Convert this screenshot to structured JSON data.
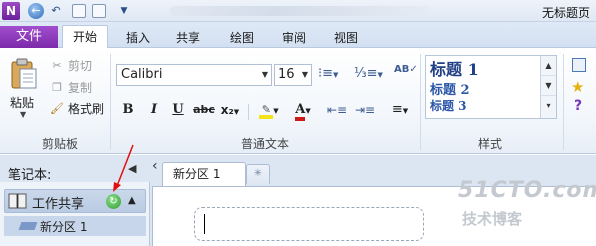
{
  "titlebar": {
    "window_title": "无标题页"
  },
  "tabs": {
    "file": "文件",
    "home": "开始",
    "insert": "插入",
    "share": "共享",
    "draw": "绘图",
    "review": "审阅",
    "view": "视图"
  },
  "clipboard": {
    "paste": "粘贴",
    "cut": "剪切",
    "copy": "复制",
    "format_painter": "格式刷",
    "group_label": "剪贴板"
  },
  "basic_text": {
    "font_name": "Calibri",
    "font_size": "16",
    "bold": "B",
    "italic": "I",
    "underline": "U",
    "strike": "abc",
    "subscript": "x₂",
    "group_label": "普通文本"
  },
  "styles": {
    "items": [
      "标题 1",
      "标题 2",
      "标题 3"
    ],
    "group_label": "样式"
  },
  "notebook_pane": {
    "label": "笔记本:",
    "notebook_name": "工作共享",
    "section_name": "新分区 1"
  },
  "section_tabs": {
    "active_tab": "新分区 1"
  },
  "watermark": {
    "line1": "51CTO.com",
    "line2": "技术博客"
  },
  "colors": {
    "file_tab": "#8a36b8",
    "heading_style": "#1f3f86",
    "font_color_red": "#d01818",
    "highlight_yellow": "#f4e21a"
  }
}
